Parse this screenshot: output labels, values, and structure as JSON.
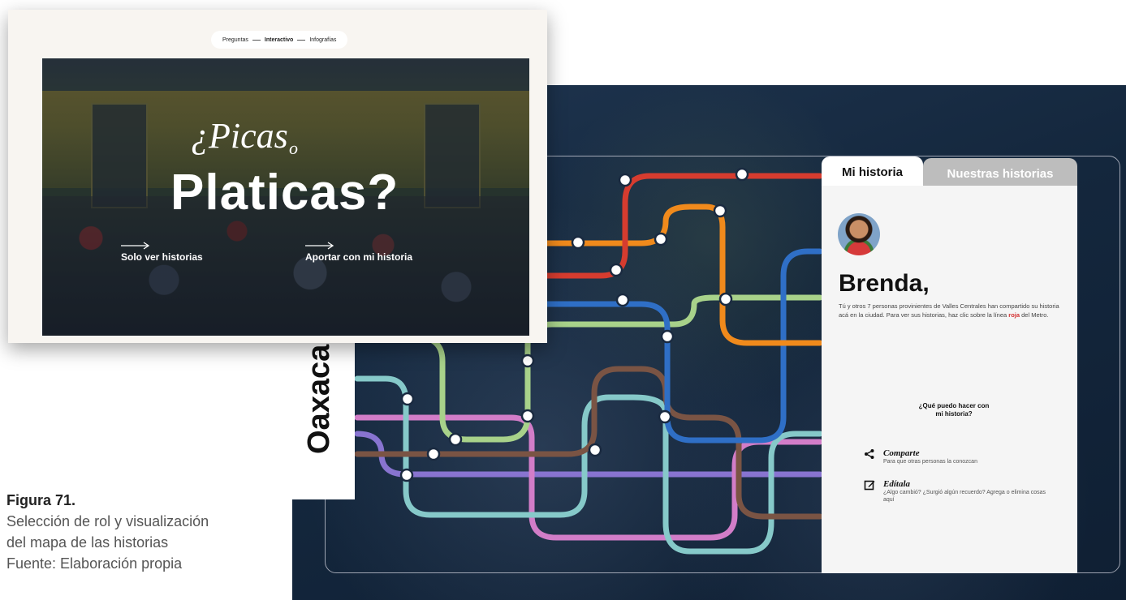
{
  "nav": {
    "items": [
      "Preguntas",
      "Interactivo",
      "Infografías"
    ],
    "active_index": 1
  },
  "hero": {
    "title_part1": "¿Picas",
    "title_connector": "o",
    "title_part2": "Platicas?",
    "link_view": "Solo ver historias",
    "link_contribute": "Aportar con mi historia"
  },
  "map": {
    "region_label": "Oaxaca",
    "lines": [
      {
        "name": "roja",
        "color": "#d63c2f"
      },
      {
        "name": "naranja",
        "color": "#f08a1c"
      },
      {
        "name": "azul",
        "color": "#2f6fc6"
      },
      {
        "name": "verde",
        "color": "#a8d28a"
      },
      {
        "name": "cafe",
        "color": "#7a5444"
      },
      {
        "name": "turquesa",
        "color": "#86c9c9"
      },
      {
        "name": "rosa",
        "color": "#d27dc8"
      },
      {
        "name": "morada",
        "color": "#8874d0"
      }
    ]
  },
  "panel": {
    "tab_mine": "Mi historia",
    "tab_ours": "Nuestras historias",
    "name": "Brenda,",
    "description_before": "Tú y otros 7 personas provinientes de Valles Centrales han compartido su historia acá en la ciudad. Para ver sus historias, haz clic sobre la línea ",
    "description_highlight": "roja",
    "description_after": " del Metro.",
    "question_line1": "¿Qué puedo hacer con",
    "question_line2": "mi historia?",
    "actions": [
      {
        "icon": "share-icon",
        "title": "Comparte",
        "subtitle": "Para que otras personas la conozcan"
      },
      {
        "icon": "edit-icon",
        "title": "Edítala",
        "subtitle": "¿Algo cambió? ¿Surgió algún recuerdo? Agrega o elimina cosas aquí"
      }
    ]
  },
  "caption": {
    "figure": "Figura 71.",
    "line1": "Selección de rol y visualización",
    "line2": "del mapa de las historias",
    "line3": "Fuente: Elaboración propia"
  }
}
